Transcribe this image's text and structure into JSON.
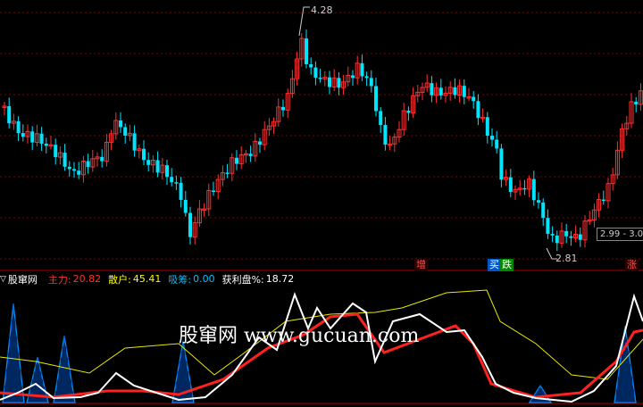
{
  "main_chart": {
    "high_label": "4.28",
    "low_label": "2.81",
    "price_box": "2.99 - 3.00",
    "flags": [
      {
        "text": "增",
        "color": "#ff5050",
        "bg": "#2a0000"
      },
      {
        "text": "买",
        "color": "#ffffff",
        "bg": "#0055cc"
      },
      {
        "text": "跌",
        "color": "#ffffff",
        "bg": "#008800"
      },
      {
        "text": "涨",
        "color": "#ff5050",
        "bg": "#2a0000"
      }
    ],
    "colors": {
      "up": "#ff3030",
      "down": "#00e5ff",
      "grid": "#800000"
    }
  },
  "indicator": {
    "name": "股窜网",
    "items": [
      {
        "label": "主力:",
        "value": "20.82",
        "color": "#ff3030"
      },
      {
        "label": "散户:",
        "value": "45.41",
        "color": "#ffff00"
      },
      {
        "label": "吸筹:",
        "value": "0.00",
        "color": "#00bfff"
      },
      {
        "label": "获利盘%:",
        "value": "18.72",
        "color": "#ffffff"
      }
    ],
    "watermark": "股窜网 www.gucuan.com"
  }
}
